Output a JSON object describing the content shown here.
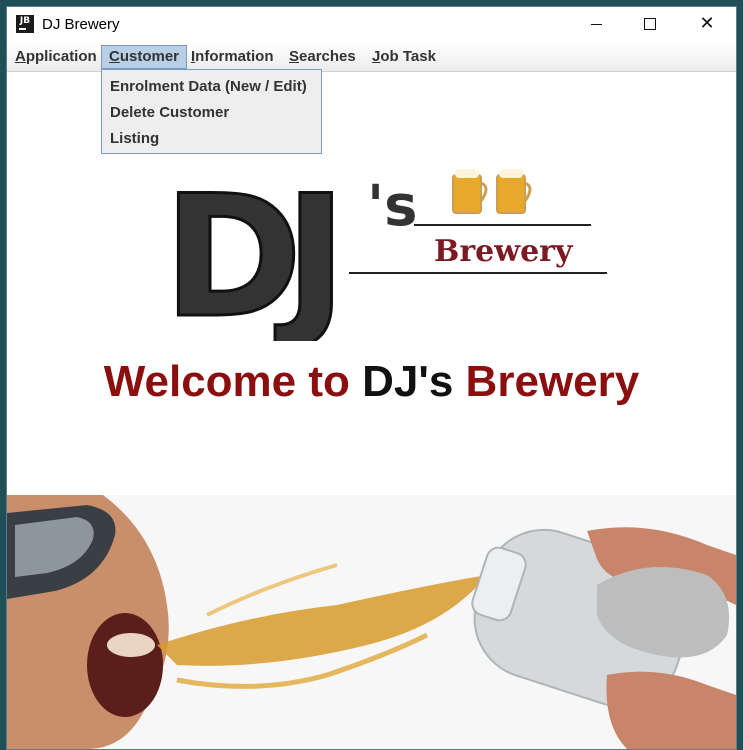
{
  "window": {
    "title": "DJ Brewery",
    "icon_label": "JB"
  },
  "menubar": {
    "items": [
      {
        "mnemonic": "A",
        "rest": "pplication"
      },
      {
        "mnemonic": "C",
        "rest": "ustomer"
      },
      {
        "mnemonic": "I",
        "rest": "nformation"
      },
      {
        "mnemonic": "S",
        "rest": "earches"
      },
      {
        "mnemonic": "J",
        "rest": "ob Task"
      }
    ]
  },
  "customer_menu": {
    "items": [
      "Enrolment Data (New / Edit)",
      "Delete Customer",
      "Listing"
    ]
  },
  "logo": {
    "initials": "DJ",
    "suffix": "'s",
    "brand": "Brewery"
  },
  "welcome": {
    "part1": "Welcome to ",
    "part2": "DJ's",
    "part3": " Brewery"
  },
  "colors": {
    "brand_red": "#8b0f0f",
    "menu_highlight": "#b8cfe5"
  }
}
